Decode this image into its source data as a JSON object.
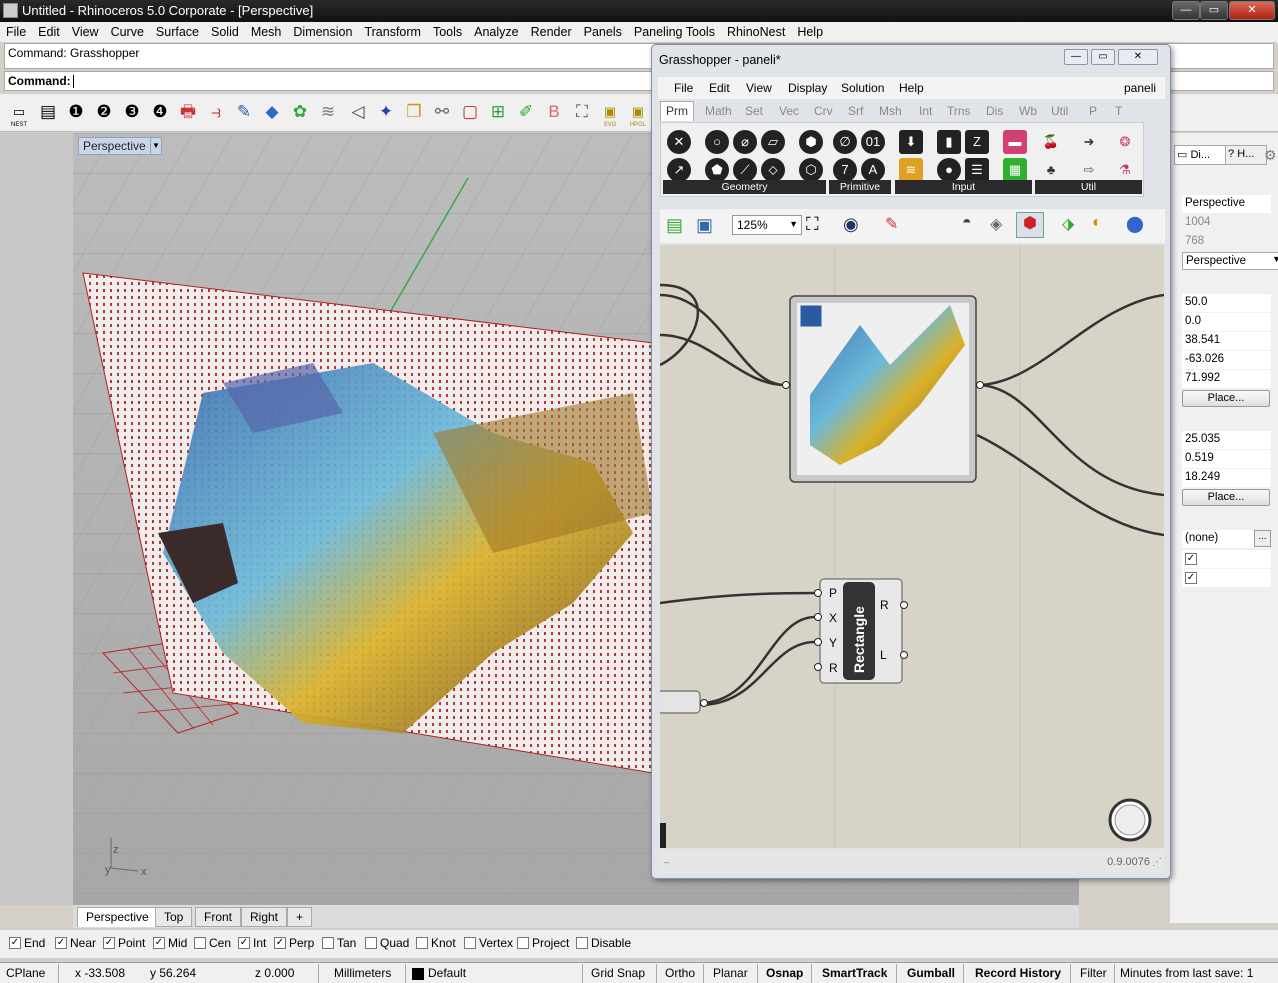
{
  "window": {
    "title": "Untitled - Rhinoceros  5.0 Corporate - [Perspective]",
    "min": "—",
    "max": "▭",
    "close": "✕"
  },
  "menu": [
    "File",
    "Edit",
    "View",
    "Curve",
    "Surface",
    "Solid",
    "Mesh",
    "Dimension",
    "Transform",
    "Tools",
    "Analyze",
    "Render",
    "Panels",
    "Paneling Tools",
    "RhinoNest",
    "Help"
  ],
  "command": {
    "history": "Command: Grasshopper",
    "prompt": "Command:"
  },
  "toolbar": {
    "nest_label": "NEST",
    "svg_label": "SVG",
    "hpgl_label": "HPGL"
  },
  "viewport": {
    "title": "Perspective",
    "axis_z": "z",
    "axis_y": "y",
    "axis_x": "x"
  },
  "viewport_tabs": [
    "Perspective",
    "Top",
    "Front",
    "Right",
    "+"
  ],
  "osnaps": [
    {
      "label": "End",
      "checked": true
    },
    {
      "label": "Near",
      "checked": true
    },
    {
      "label": "Point",
      "checked": true
    },
    {
      "label": "Mid",
      "checked": true
    },
    {
      "label": "Cen",
      "checked": false
    },
    {
      "label": "Int",
      "checked": true
    },
    {
      "label": "Perp",
      "checked": true
    },
    {
      "label": "Tan",
      "checked": false
    },
    {
      "label": "Quad",
      "checked": false
    },
    {
      "label": "Knot",
      "checked": false
    },
    {
      "label": "Vertex",
      "checked": false
    },
    {
      "label": "Project",
      "checked": false
    },
    {
      "label": "Disable",
      "checked": false
    }
  ],
  "status": {
    "cplane": "CPlane",
    "x": "x -33.508",
    "y": "y 56.264",
    "z": "z 0.000",
    "units": "Millimeters",
    "layer": "Default",
    "grid_snap": "Grid Snap",
    "ortho": "Ortho",
    "planar": "Planar",
    "osnap": "Osnap",
    "smarttrack": "SmartTrack",
    "gumball": "Gumball",
    "record_history": "Record History",
    "filter": "Filter",
    "minutes": "Minutes from last save: 1"
  },
  "properties": {
    "tab1": "Di...",
    "tab2": "H...",
    "view_name": "Perspective",
    "width": "1004",
    "height": "768",
    "projection": "Perspective",
    "lens": "50.0",
    "rotation": "0.0",
    "cam_x": "38.541",
    "cam_y": "-63.026",
    "cam_z": "71.992",
    "place1": "Place...",
    "tgt_x": "25.035",
    "tgt_y": "0.519",
    "tgt_z": "18.249",
    "place2": "Place...",
    "wallpaper": "(none)",
    "browse": "..."
  },
  "grasshopper": {
    "title": "Grasshopper - paneli*",
    "doc_name": "paneli",
    "menu": [
      "File",
      "Edit",
      "View",
      "Display",
      "Solution",
      "Help"
    ],
    "tabs": [
      "Prm",
      "Math",
      "Set",
      "Vec",
      "Crv",
      "Srf",
      "Msh",
      "Int",
      "Trns",
      "Dis",
      "Wb",
      "Util",
      "P",
      "T"
    ],
    "ribbon_groups": [
      "Geometry",
      "Primitive",
      "Input",
      "Util"
    ],
    "zoom": "125%",
    "rect_component": {
      "name": "Rectangle",
      "inputs": [
        "P",
        "X",
        "Y",
        "R"
      ],
      "outputs": [
        "R",
        "L"
      ]
    },
    "version": "0.9.0076"
  }
}
